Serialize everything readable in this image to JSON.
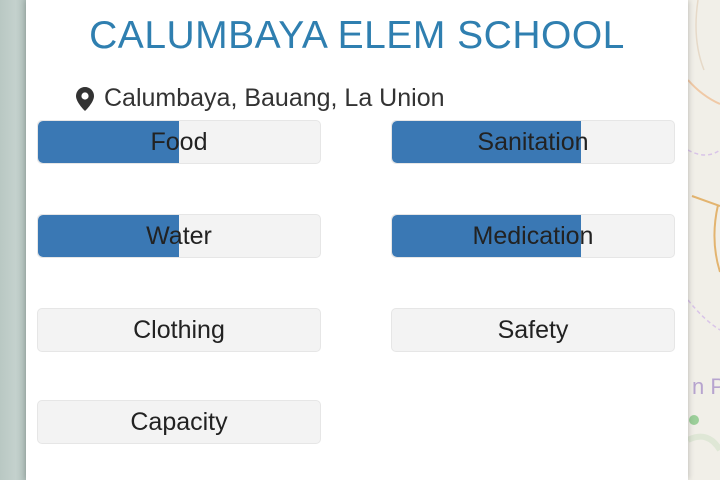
{
  "school": {
    "name": "CALUMBAYA ELEM SCHOOL",
    "location": "Calumbaya, Bauang, La Union"
  },
  "needs": [
    {
      "label": "Food",
      "level": 0.5
    },
    {
      "label": "Sanitation",
      "level": 0.67
    },
    {
      "label": "Water",
      "level": 0.5
    },
    {
      "label": "Medication",
      "level": 0.67
    },
    {
      "label": "Clothing",
      "level": 0
    },
    {
      "label": "Safety",
      "level": 0
    },
    {
      "label": "Capacity",
      "level": 0
    }
  ],
  "map": {
    "label_fragment": "n Pr"
  },
  "icons": {
    "location": "map-marker-icon"
  },
  "colors": {
    "title": "#2f7fb0",
    "bar_fill": "#3a78b4",
    "bar_background": "#f3f3f3"
  }
}
